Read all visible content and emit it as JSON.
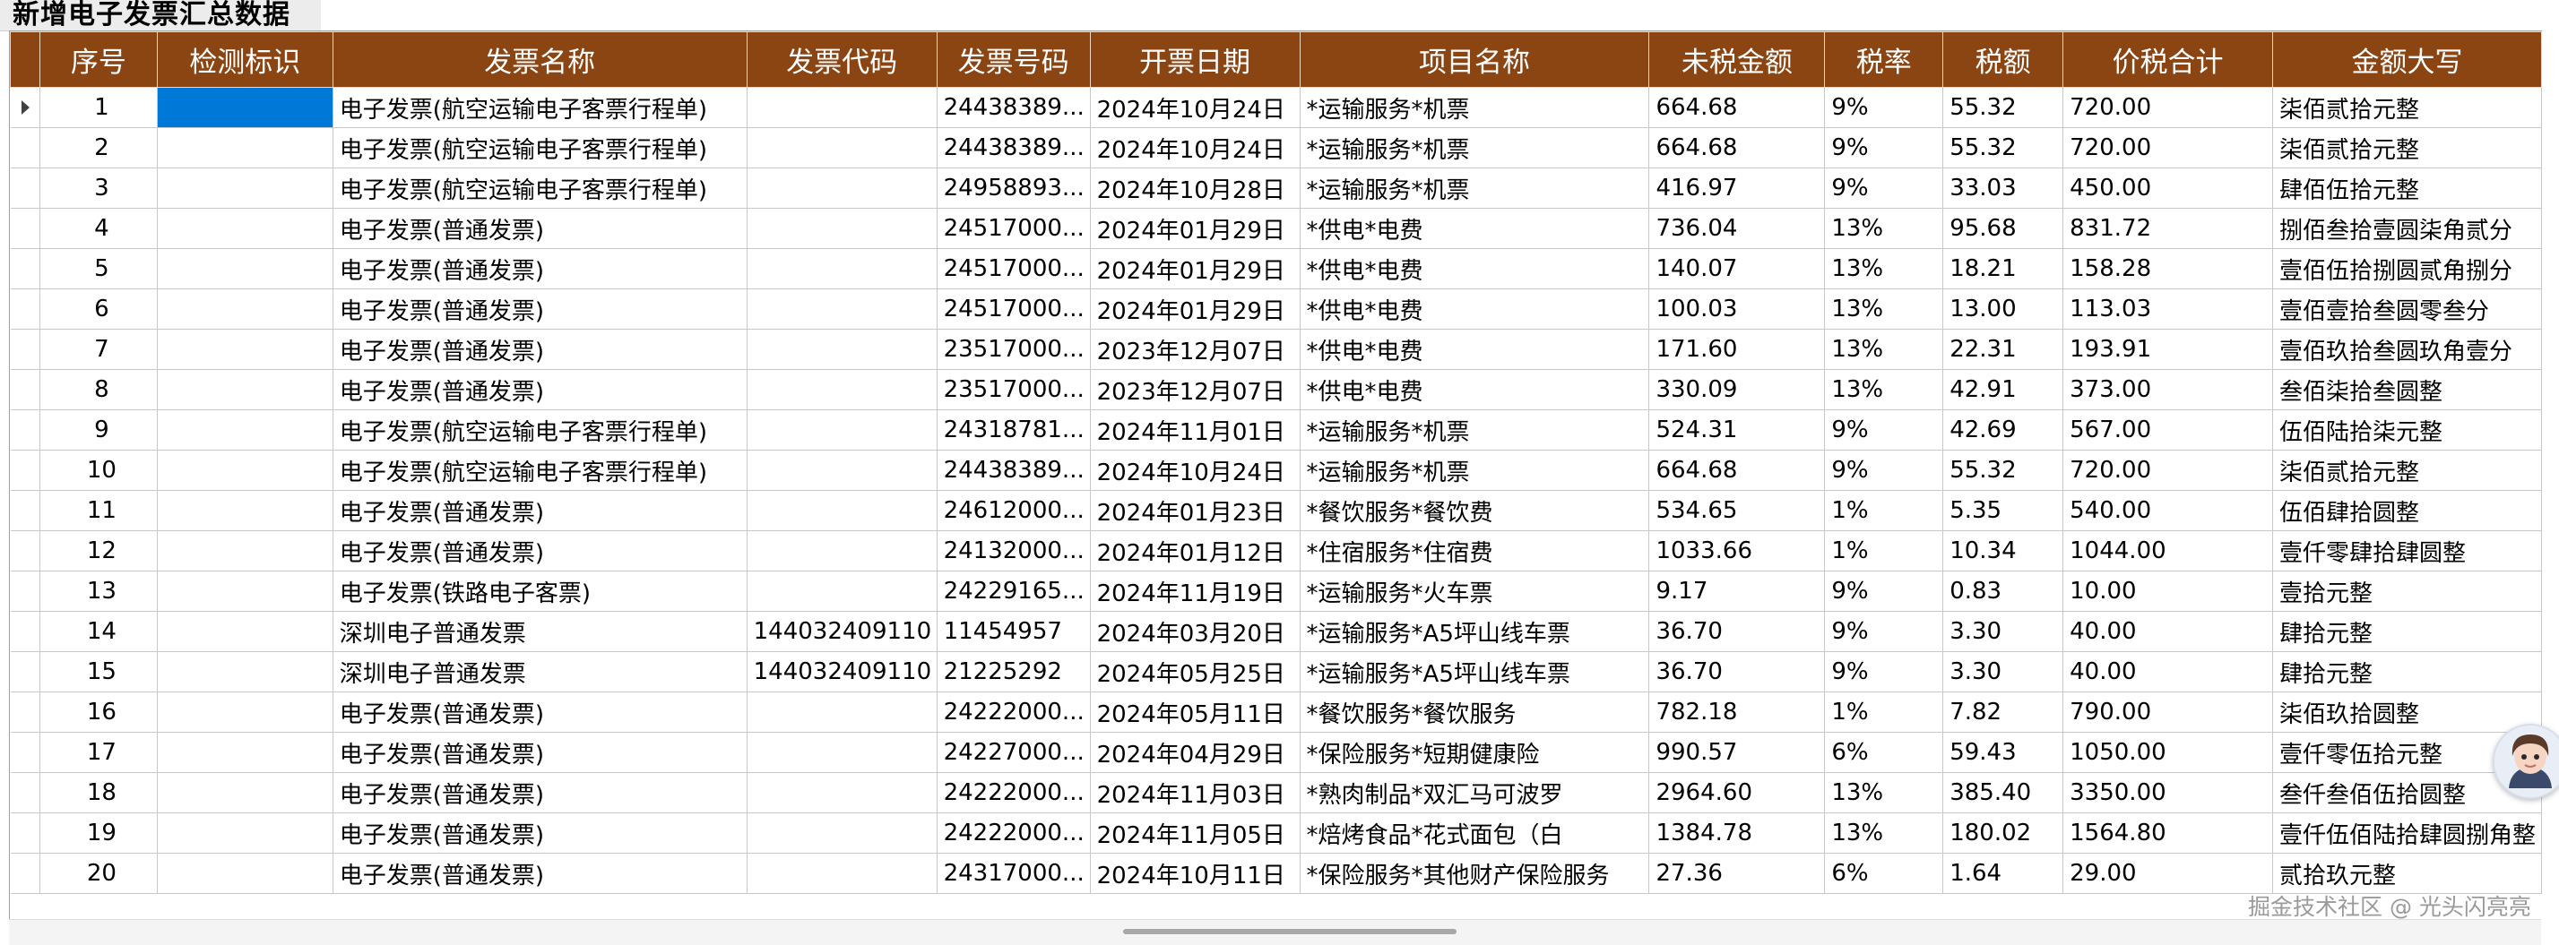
{
  "title": "新增电子发票汇总数据",
  "columns": [
    "",
    "序号",
    "检测标识",
    "发票名称",
    "发票代码",
    "发票号码",
    "开票日期",
    "项目名称",
    "未税金额",
    "税率",
    "税额",
    "价税合计",
    "金额大写"
  ],
  "rows": [
    {
      "seq": "1",
      "flag": "",
      "name": "电子发票(航空运输电子客票行程单)",
      "code": "",
      "number": "24438389...",
      "date": "2024年10月24日",
      "item": "*运输服务*机票",
      "net": "664.68",
      "rate": "9%",
      "tax": "55.32",
      "total": "720.00",
      "words": "柒佰贰拾元整"
    },
    {
      "seq": "2",
      "flag": "",
      "name": "电子发票(航空运输电子客票行程单)",
      "code": "",
      "number": "24438389...",
      "date": "2024年10月24日",
      "item": "*运输服务*机票",
      "net": "664.68",
      "rate": "9%",
      "tax": "55.32",
      "total": "720.00",
      "words": "柒佰贰拾元整"
    },
    {
      "seq": "3",
      "flag": "",
      "name": "电子发票(航空运输电子客票行程单)",
      "code": "",
      "number": "24958893...",
      "date": "2024年10月28日",
      "item": "*运输服务*机票",
      "net": "416.97",
      "rate": "9%",
      "tax": "33.03",
      "total": "450.00",
      "words": "肆佰伍拾元整"
    },
    {
      "seq": "4",
      "flag": "",
      "name": "电子发票(普通发票)",
      "code": "",
      "number": "24517000...",
      "date": "2024年01月29日",
      "item": "*供电*电费",
      "net": "736.04",
      "rate": "13%",
      "tax": "95.68",
      "total": "831.72",
      "words": "捌佰叁拾壹圆柒角贰分"
    },
    {
      "seq": "5",
      "flag": "",
      "name": "电子发票(普通发票)",
      "code": "",
      "number": "24517000...",
      "date": "2024年01月29日",
      "item": "*供电*电费",
      "net": "140.07",
      "rate": "13%",
      "tax": "18.21",
      "total": "158.28",
      "words": "壹佰伍拾捌圆贰角捌分"
    },
    {
      "seq": "6",
      "flag": "",
      "name": "电子发票(普通发票)",
      "code": "",
      "number": "24517000...",
      "date": "2024年01月29日",
      "item": "*供电*电费",
      "net": "100.03",
      "rate": "13%",
      "tax": "13.00",
      "total": "113.03",
      "words": "壹佰壹拾叁圆零叁分"
    },
    {
      "seq": "7",
      "flag": "",
      "name": "电子发票(普通发票)",
      "code": "",
      "number": "23517000...",
      "date": "2023年12月07日",
      "item": "*供电*电费",
      "net": "171.60",
      "rate": "13%",
      "tax": "22.31",
      "total": "193.91",
      "words": "壹佰玖拾叁圆玖角壹分"
    },
    {
      "seq": "8",
      "flag": "",
      "name": "电子发票(普通发票)",
      "code": "",
      "number": "23517000...",
      "date": "2023年12月07日",
      "item": "*供电*电费",
      "net": "330.09",
      "rate": "13%",
      "tax": "42.91",
      "total": "373.00",
      "words": "叁佰柒拾叁圆整"
    },
    {
      "seq": "9",
      "flag": "",
      "name": "电子发票(航空运输电子客票行程单)",
      "code": "",
      "number": "24318781...",
      "date": "2024年11月01日",
      "item": "*运输服务*机票",
      "net": "524.31",
      "rate": "9%",
      "tax": "42.69",
      "total": "567.00",
      "words": "伍佰陆拾柒元整"
    },
    {
      "seq": "10",
      "flag": "",
      "name": "电子发票(航空运输电子客票行程单)",
      "code": "",
      "number": "24438389...",
      "date": "2024年10月24日",
      "item": "*运输服务*机票",
      "net": "664.68",
      "rate": "9%",
      "tax": "55.32",
      "total": "720.00",
      "words": "柒佰贰拾元整"
    },
    {
      "seq": "11",
      "flag": "",
      "name": "电子发票(普通发票)",
      "code": "",
      "number": "24612000...",
      "date": "2024年01月23日",
      "item": "*餐饮服务*餐饮费",
      "net": "534.65",
      "rate": "1%",
      "tax": "5.35",
      "total": "540.00",
      "words": "伍佰肆拾圆整"
    },
    {
      "seq": "12",
      "flag": "",
      "name": "电子发票(普通发票)",
      "code": "",
      "number": "24132000...",
      "date": "2024年01月12日",
      "item": "*住宿服务*住宿费",
      "net": "1033.66",
      "rate": "1%",
      "tax": "10.34",
      "total": "1044.00",
      "words": "壹仟零肆拾肆圆整"
    },
    {
      "seq": "13",
      "flag": "",
      "name": "电子发票(铁路电子客票)",
      "code": "",
      "number": "24229165...",
      "date": "2024年11月19日",
      "item": "*运输服务*火车票",
      "net": "9.17",
      "rate": "9%",
      "tax": "0.83",
      "total": "10.00",
      "words": "壹拾元整"
    },
    {
      "seq": "14",
      "flag": "",
      "name": "深圳电子普通发票",
      "code": "144032409110",
      "number": "11454957",
      "date": "2024年03月20日",
      "item": "*运输服务*A5坪山线车票",
      "net": "36.70",
      "rate": "9%",
      "tax": "3.30",
      "total": "40.00",
      "words": "肆拾元整"
    },
    {
      "seq": "15",
      "flag": "",
      "name": "深圳电子普通发票",
      "code": "144032409110",
      "number": "21225292",
      "date": "2024年05月25日",
      "item": "*运输服务*A5坪山线车票",
      "net": "36.70",
      "rate": "9%",
      "tax": "3.30",
      "total": "40.00",
      "words": "肆拾元整"
    },
    {
      "seq": "16",
      "flag": "",
      "name": "电子发票(普通发票)",
      "code": "",
      "number": "24222000...",
      "date": "2024年05月11日",
      "item": "*餐饮服务*餐饮服务",
      "net": "782.18",
      "rate": "1%",
      "tax": "7.82",
      "total": "790.00",
      "words": "柒佰玖拾圆整"
    },
    {
      "seq": "17",
      "flag": "",
      "name": "电子发票(普通发票)",
      "code": "",
      "number": "24227000...",
      "date": "2024年04月29日",
      "item": "*保险服务*短期健康险",
      "net": "990.57",
      "rate": "6%",
      "tax": "59.43",
      "total": "1050.00",
      "words": "壹仟零伍拾元整"
    },
    {
      "seq": "18",
      "flag": "",
      "name": "电子发票(普通发票)",
      "code": "",
      "number": "24222000...",
      "date": "2024年11月03日",
      "item": "*熟肉制品*双汇马可波罗",
      "net": "2964.60",
      "rate": "13%",
      "tax": "385.40",
      "total": "3350.00",
      "words": "叁仟叁佰伍拾圆整"
    },
    {
      "seq": "19",
      "flag": "",
      "name": "电子发票(普通发票)",
      "code": "",
      "number": "24222000...",
      "date": "2024年11月05日",
      "item": "*焙烤食品*花式面包（白",
      "net": "1384.78",
      "rate": "13%",
      "tax": "180.02",
      "total": "1564.80",
      "words": "壹仟伍佰陆拾肆圆捌角整"
    },
    {
      "seq": "20",
      "flag": "",
      "name": "电子发票(普通发票)",
      "code": "",
      "number": "24317000...",
      "date": "2024年10月11日",
      "item": "*保险服务*其他财产保险服务",
      "net": "27.36",
      "rate": "6%",
      "tax": "1.64",
      "total": "29.00",
      "words": "贰拾玖元整"
    }
  ],
  "watermark": "掘金技术社区 @ 光头闪亮亮",
  "colors": {
    "header_bg": "#8B4513",
    "header_text": "#ffffff",
    "selected_cell": "#0078d7",
    "grid_line": "#c8c8c8"
  }
}
